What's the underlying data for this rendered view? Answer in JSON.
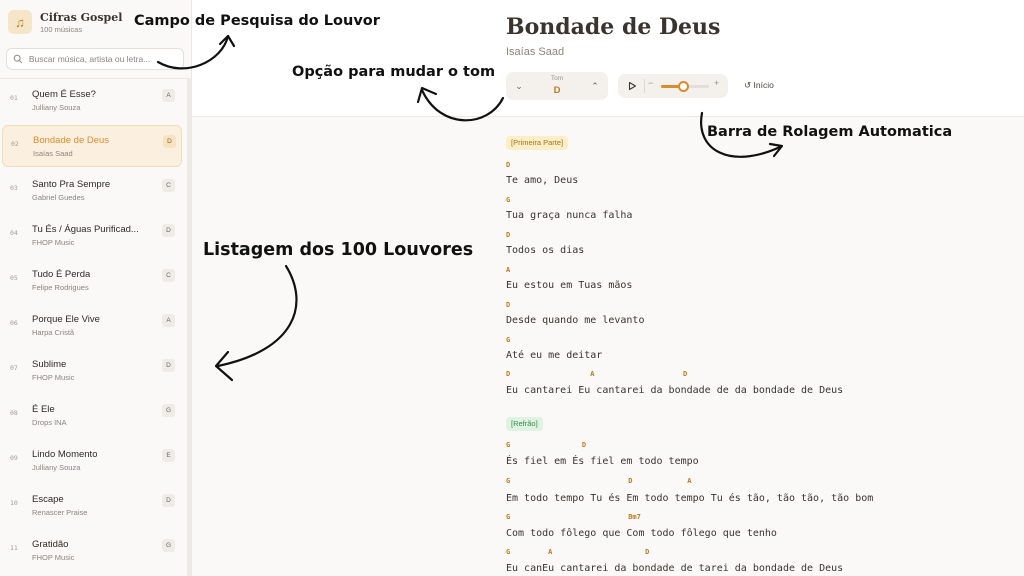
{
  "sidebar": {
    "brand_title": "Cifras Gospel",
    "brand_subtitle": "100 músicas",
    "search_placeholder": "Buscar música, artista ou letra...",
    "songs": [
      {
        "num": "01",
        "title": "Quem É Esse?",
        "artist": "Julliany Souza",
        "key": "A"
      },
      {
        "num": "02",
        "title": "Bondade de Deus",
        "artist": "Isaías Saad",
        "key": "D",
        "active": true
      },
      {
        "num": "03",
        "title": "Santo Pra Sempre",
        "artist": "Gabriel Guedes",
        "key": "C"
      },
      {
        "num": "04",
        "title": "Tu És / Águas Purificad...",
        "artist": "FHOP Music",
        "key": "D"
      },
      {
        "num": "05",
        "title": "Tudo É Perda",
        "artist": "Felipe Rodrigues",
        "key": "C"
      },
      {
        "num": "06",
        "title": "Porque Ele Vive",
        "artist": "Harpa Cristã",
        "key": "A"
      },
      {
        "num": "07",
        "title": "Sublime",
        "artist": "FHOP Music",
        "key": "D"
      },
      {
        "num": "08",
        "title": "É Ele",
        "artist": "Drops INA",
        "key": "G"
      },
      {
        "num": "09",
        "title": "Lindo Momento",
        "artist": "Julliany Souza",
        "key": "E"
      },
      {
        "num": "10",
        "title": "Escape",
        "artist": "Renascer Praise",
        "key": "D"
      },
      {
        "num": "11",
        "title": "Gratidão",
        "artist": "FHOP Music",
        "key": "G"
      }
    ]
  },
  "header": {
    "title": "Bondade de Deus",
    "artist": "Isaías Saad",
    "tone_label": "Tom",
    "tone_value": "D",
    "minus": "−",
    "plus": "+",
    "restart_label": "Início",
    "autoscroll_speed_fraction": 0.45
  },
  "sheet": {
    "section1_tag": "[Primeira Parte]",
    "section2_tag": "[Refrão]",
    "lines": [
      {
        "chords": "D",
        "lyric": "Te amo, Deus"
      },
      {
        "chords": "G",
        "lyric": "Tua graça nunca falha"
      },
      {
        "chords": "D",
        "lyric": "Todos os dias"
      },
      {
        "chords": "A",
        "lyric": "Eu estou em Tuas mãos"
      },
      {
        "chords": "D",
        "lyric": "Desde quando me levanto"
      },
      {
        "chords": "G",
        "lyric": "Até eu me deitar"
      },
      {
        "chords": "D                   A                     D",
        "lyric": "Eu cantarei Eu cantarei da bondade de da bondade de Deus"
      },
      {
        "chords": "G                 D",
        "lyric": "És fiel em És fiel em todo tempo"
      },
      {
        "chords": "G                            D             A",
        "lyric": "Em todo tempo Tu és Em todo tempo Tu és tão, tão tão, tão bom"
      },
      {
        "chords": "G                            Bm7",
        "lyric": "Com todo fôlego que Com todo fôlego que tenho"
      },
      {
        "chords": "G         A                      D",
        "lyric": "Eu canEu cantarei da bondade de tarei da bondade de Deus"
      }
    ]
  },
  "annotations": {
    "search": "Campo de Pesquisa do Louvor",
    "tone": "Opção para mudar o tom",
    "autoscroll": "Barra de Rolagem Automatica",
    "list": "Listagem dos 100 Louvores"
  },
  "colors": {
    "accent": "#d98c2b",
    "accent_dark": "#c07a1f",
    "active_bg": "#fbf0e0",
    "part_tag_bg": "#fcefc7",
    "refrain_tag_bg": "#dff3e3"
  }
}
